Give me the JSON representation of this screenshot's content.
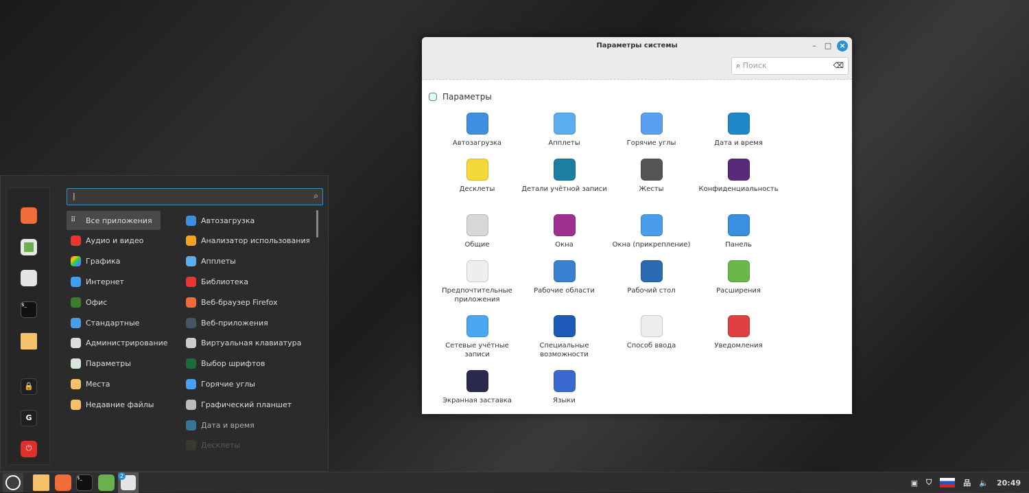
{
  "menu": {
    "search_value": "",
    "categories": [
      "Все приложения",
      "Аудио и видео",
      "Графика",
      "Интернет",
      "Офис",
      "Стандартные",
      "Администрирование",
      "Параметры",
      "Места",
      "Недавние файлы"
    ],
    "apps": [
      "Автозагрузка",
      "Анализатор использования…",
      "Апплеты",
      "Библиотека",
      "Веб-браузер Firefox",
      "Веб-приложения",
      "Виртуальная клавиатура",
      "Выбор шрифтов",
      "Горячие углы",
      "Графический планшет",
      "Дата и время",
      "Десклеты"
    ],
    "favorites": [
      "firefox-icon",
      "software-manager-icon",
      "settings-icon",
      "terminal-icon",
      "folder-icon",
      "lock-icon",
      "logout-icon",
      "power-icon"
    ]
  },
  "window": {
    "title": "Параметры системы",
    "search_placeholder": "Поиск",
    "section": "Параметры",
    "items": [
      "Автозагрузка",
      "Апплеты",
      "Горячие углы",
      "Дата и время",
      "Десклеты",
      "Детали учётной записи",
      "Жесты",
      "Конфиденциальность",
      "Общие",
      "Окна",
      "Окна (прикрепление)",
      "Панель",
      "Предпочтительные приложения",
      "Рабочие области",
      "Рабочий стол",
      "Расширения",
      "Сетевые учётные записи",
      "Специальные возможности",
      "Способ ввода",
      "Уведомления",
      "Экранная заставка",
      "Языки"
    ]
  },
  "panel": {
    "badge": "2",
    "clock": "20:49"
  }
}
